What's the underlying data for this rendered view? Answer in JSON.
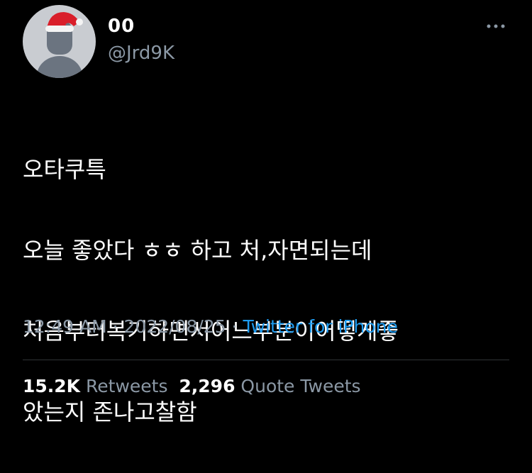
{
  "user": {
    "display_name": "00",
    "handle": "@Jrd9K",
    "avatar_icon": "default-avatar-with-santa-hat-icon"
  },
  "header": {
    "more_icon": "more-horizontal-icon"
  },
  "tweet": {
    "lines": [
      "오타쿠특",
      "오늘 좋았다 ㅎㅎ 하고 처,자면되는데",
      "처음부터복기하면서어느부분이어떻게좋",
      "았는지 존나고찰함"
    ],
    "time": "12:49 AM",
    "separator1": " · ",
    "date": "2022/08/25",
    "separator2": " · ",
    "source": "Twitter for iPhone"
  },
  "stats": {
    "retweets_count": "15.2K",
    "retweets_label": "Retweets",
    "quotes_count": "2,296",
    "quotes_label": "Quote Tweets"
  },
  "colors": {
    "background": "#000000",
    "text": "#ffffff",
    "secondary": "#8b98a5",
    "accent": "#1d9bf0",
    "divider": "#2f3336"
  }
}
